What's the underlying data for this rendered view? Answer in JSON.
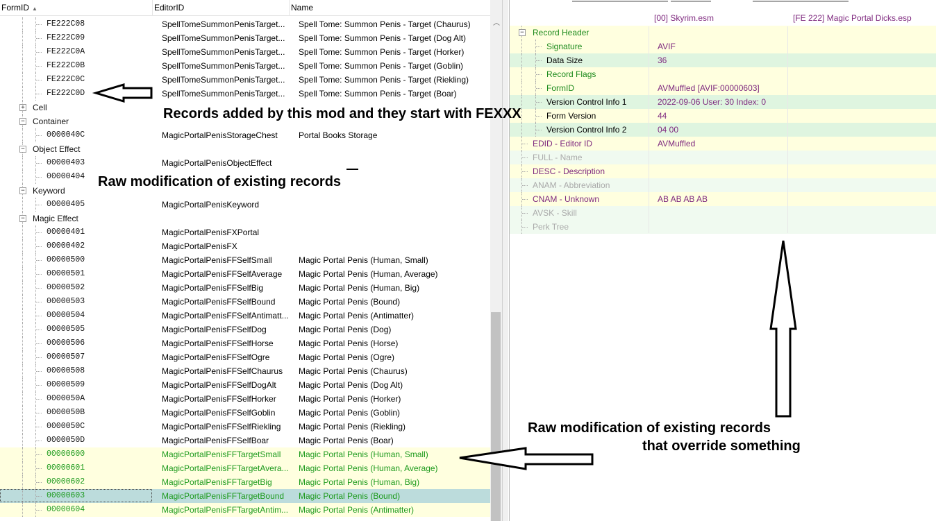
{
  "left_header": {
    "col_formid": "FormID",
    "col_editorid": "EditorID",
    "col_name": "Name"
  },
  "left_rows": [
    {
      "level": 2,
      "fid": "FE222C08",
      "eid": "SpellTomeSummonPenisTarget...",
      "name": "Spell Tome: Summon Penis - Target (Chaurus)"
    },
    {
      "level": 2,
      "fid": "FE222C09",
      "eid": "SpellTomeSummonPenisTarget...",
      "name": "Spell Tome: Summon Penis - Target (Dog Alt)"
    },
    {
      "level": 2,
      "fid": "FE222C0A",
      "eid": "SpellTomeSummonPenisTarget...",
      "name": "Spell Tome: Summon Penis - Target (Horker)"
    },
    {
      "level": 2,
      "fid": "FE222C0B",
      "eid": "SpellTomeSummonPenisTarget...",
      "name": "Spell Tome: Summon Penis - Target (Goblin)"
    },
    {
      "level": 2,
      "fid": "FE222C0C",
      "eid": "SpellTomeSummonPenisTarget...",
      "name": "Spell Tome: Summon Penis - Target (Riekling)"
    },
    {
      "level": 2,
      "fid": "FE222C0D",
      "eid": "SpellTomeSummonPenisTarget...",
      "name": "Spell Tome: Summon Penis - Target (Boar)"
    },
    {
      "level": 1,
      "cat": "Cell",
      "expander": "+"
    },
    {
      "level": 1,
      "cat": "Container",
      "expander": "-"
    },
    {
      "level": 2,
      "fid": "0000040C",
      "eid": "MagicPortalPenisStorageChest",
      "name": "Portal Books Storage"
    },
    {
      "level": 1,
      "cat": "Object Effect",
      "expander": "-"
    },
    {
      "level": 2,
      "fid": "00000403",
      "eid": "MagicPortalPenisObjectEffect",
      "name": ""
    },
    {
      "level": 2,
      "fid": "00000404",
      "eid": "",
      "name": ""
    },
    {
      "level": 1,
      "cat": "Keyword",
      "expander": "-"
    },
    {
      "level": 2,
      "fid": "00000405",
      "eid": "MagicPortalPenisKeyword",
      "name": ""
    },
    {
      "level": 1,
      "cat": "Magic Effect",
      "expander": "-"
    },
    {
      "level": 2,
      "fid": "00000401",
      "eid": "MagicPortalPenisFXPortal",
      "name": ""
    },
    {
      "level": 2,
      "fid": "00000402",
      "eid": "MagicPortalPenisFX",
      "name": ""
    },
    {
      "level": 2,
      "fid": "00000500",
      "eid": "MagicPortalPenisFFSelfSmall",
      "name": "Magic Portal Penis (Human, Small)"
    },
    {
      "level": 2,
      "fid": "00000501",
      "eid": "MagicPortalPenisFFSelfAverage",
      "name": "Magic Portal Penis (Human, Average)"
    },
    {
      "level": 2,
      "fid": "00000502",
      "eid": "MagicPortalPenisFFSelfBig",
      "name": "Magic Portal Penis (Human, Big)"
    },
    {
      "level": 2,
      "fid": "00000503",
      "eid": "MagicPortalPenisFFSelfBound",
      "name": "Magic Portal Penis (Bound)"
    },
    {
      "level": 2,
      "fid": "00000504",
      "eid": "MagicPortalPenisFFSelfAntimatt...",
      "name": "Magic Portal Penis (Antimatter)"
    },
    {
      "level": 2,
      "fid": "00000505",
      "eid": "MagicPortalPenisFFSelfDog",
      "name": "Magic Portal Penis (Dog)"
    },
    {
      "level": 2,
      "fid": "00000506",
      "eid": "MagicPortalPenisFFSelfHorse",
      "name": "Magic Portal Penis (Horse)"
    },
    {
      "level": 2,
      "fid": "00000507",
      "eid": "MagicPortalPenisFFSelfOgre",
      "name": "Magic Portal Penis (Ogre)"
    },
    {
      "level": 2,
      "fid": "00000508",
      "eid": "MagicPortalPenisFFSelfChaurus",
      "name": "Magic Portal Penis (Chaurus)"
    },
    {
      "level": 2,
      "fid": "00000509",
      "eid": "MagicPortalPenisFFSelfDogAlt",
      "name": "Magic Portal Penis (Dog Alt)"
    },
    {
      "level": 2,
      "fid": "0000050A",
      "eid": "MagicPortalPenisFFSelfHorker",
      "name": "Magic Portal Penis (Horker)"
    },
    {
      "level": 2,
      "fid": "0000050B",
      "eid": "MagicPortalPenisFFSelfGoblin",
      "name": "Magic Portal Penis (Goblin)"
    },
    {
      "level": 2,
      "fid": "0000050C",
      "eid": "MagicPortalPenisFFSelfRiekling",
      "name": "Magic Portal Penis (Riekling)"
    },
    {
      "level": 2,
      "fid": "0000050D",
      "eid": "MagicPortalPenisFFSelfBoar",
      "name": "Magic Portal Penis (Boar)"
    },
    {
      "level": 2,
      "fid": "00000600",
      "eid": "MagicPortalPenisFFTargetSmall",
      "name": "Magic Portal Penis (Human, Small)",
      "style": "override"
    },
    {
      "level": 2,
      "fid": "00000601",
      "eid": "MagicPortalPenisFFTargetAvera...",
      "name": "Magic Portal Penis (Human, Average)",
      "style": "override"
    },
    {
      "level": 2,
      "fid": "00000602",
      "eid": "MagicPortalPenisFFTargetBig",
      "name": "Magic Portal Penis (Human, Big)",
      "style": "override"
    },
    {
      "level": 2,
      "fid": "00000603",
      "eid": "MagicPortalPenisFFTargetBound",
      "name": "Magic Portal Penis (Bound)",
      "style": "selected"
    },
    {
      "level": 2,
      "fid": "00000604",
      "eid": "MagicPortalPenisFFTargetAntim...",
      "name": "Magic Portal Penis (Antimatter)",
      "style": "override"
    }
  ],
  "right_header": {
    "col1": "[00] Skyrim.esm",
    "col2": "[FE 222] Magic Portal Dicks.esp"
  },
  "right_rows": [
    {
      "level": 0,
      "label": "Record Header",
      "value": "",
      "bg": "yellow",
      "color": "green",
      "expander": "-"
    },
    {
      "level": 1,
      "label": "Signature",
      "value": "AVIF",
      "bg": "yellow",
      "color": "green"
    },
    {
      "level": 1,
      "label": "Data Size",
      "value": "36",
      "bg": "green",
      "color": "black"
    },
    {
      "level": 1,
      "label": "Record Flags",
      "value": "",
      "bg": "yellow",
      "color": "green"
    },
    {
      "level": 1,
      "label": "FormID",
      "value": "AVMuffled [AVIF:00000603]",
      "bg": "yellow",
      "color": "green"
    },
    {
      "level": 1,
      "label": "Version Control Info 1",
      "value": "2022-09-06 User: 30 Index: 0",
      "bg": "green",
      "color": "black"
    },
    {
      "level": 1,
      "label": "Form Version",
      "value": "44",
      "bg": "yellow",
      "color": "black"
    },
    {
      "level": 1,
      "label": "Version Control Info 2",
      "value": "04 00",
      "bg": "green",
      "color": "black"
    },
    {
      "level": 0,
      "label": "EDID - Editor ID",
      "value": "AVMuffled",
      "bg": "yellow",
      "color": "purple"
    },
    {
      "level": 0,
      "label": "FULL - Name",
      "value": "",
      "bg": "lightgreen",
      "color": "gray"
    },
    {
      "level": 0,
      "label": "DESC - Description",
      "value": "",
      "bg": "yellow",
      "color": "purple"
    },
    {
      "level": 0,
      "label": "ANAM - Abbreviation",
      "value": "",
      "bg": "lightgreen",
      "color": "gray"
    },
    {
      "level": 0,
      "label": "CNAM - Unknown",
      "value": "AB AB AB AB",
      "bg": "yellow",
      "color": "purple"
    },
    {
      "level": 0,
      "label": "AVSK - Skill",
      "value": "",
      "bg": "lightgreen",
      "color": "gray"
    },
    {
      "level": 0,
      "label": "Perk Tree",
      "value": "",
      "bg": "lightgreen",
      "color": "gray"
    }
  ],
  "annotations": {
    "a1": "Records added by this mod and they start with FEXXX",
    "a2": "Raw modification of existing records",
    "a3_line1": "Raw modification of existing records",
    "a3_line2": "that override something"
  },
  "colors": {
    "override_green": "#1c9a1c",
    "highlight_yellow": "#ffffdf",
    "selected_teal": "#bcdcdc",
    "purple_text": "#7f2a7f"
  }
}
